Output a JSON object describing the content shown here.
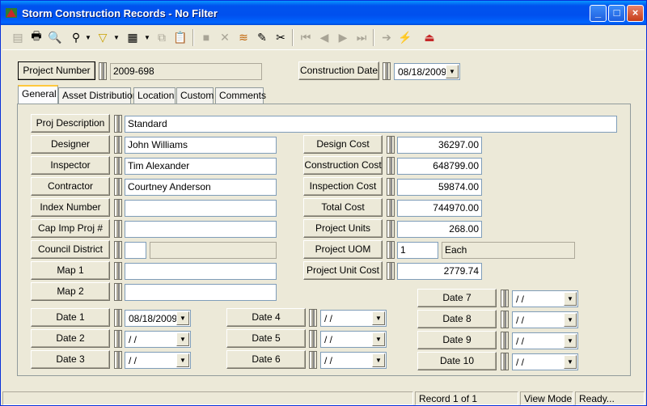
{
  "window": {
    "title": "Storm Construction Records - No Filter"
  },
  "title_buttons": {
    "minimize": "_",
    "maximize": "□",
    "close": "×"
  },
  "toolbar": {
    "icons": [
      "new-record-icon",
      "print-icon",
      "print-preview-icon",
      "find-icon",
      "filter-icon",
      "report-icon",
      "copy-icon",
      "paste-icon",
      "save-icon",
      "delete-icon",
      "add-icon",
      "edit-icon",
      "cut-icon",
      "first-record-icon",
      "previous-record-icon",
      "next-record-icon",
      "last-record-icon",
      "goto-icon",
      "refresh-icon",
      "exit-icon"
    ]
  },
  "header": {
    "project_number_label": "Project Number",
    "project_number_value": "2009-698",
    "construction_date_label": "Construction Date",
    "construction_date_value": "08/18/2009"
  },
  "tabs": [
    "General",
    "Asset Distribution",
    "Location",
    "Custom",
    "Comments"
  ],
  "active_tab": "General",
  "general": {
    "proj_description_label": "Proj Description",
    "proj_description_value": "Standard",
    "designer_label": "Designer",
    "designer_value": "John Williams",
    "inspector_label": "Inspector",
    "inspector_value": "Tim Alexander",
    "contractor_label": "Contractor",
    "contractor_value": "Courtney Anderson",
    "index_number_label": "Index Number",
    "index_number_value": "",
    "cap_imp_label": "Cap Imp Proj #",
    "cap_imp_value": "",
    "council_district_label": "Council District",
    "council_district_value": "",
    "council_district_name": "",
    "map1_label": "Map 1",
    "map1_value": "",
    "map2_label": "Map 2",
    "map2_value": "",
    "design_cost_label": "Design Cost",
    "design_cost_value": "36297.00",
    "construction_cost_label": "Construction Cost",
    "construction_cost_value": "648799.00",
    "inspection_cost_label": "Inspection Cost",
    "inspection_cost_value": "59874.00",
    "total_cost_label": "Total Cost",
    "total_cost_value": "744970.00",
    "project_units_label": "Project Units",
    "project_units_value": "268.00",
    "project_uom_label": "Project UOM",
    "project_uom_value": "1",
    "project_uom_desc": "Each",
    "project_unit_cost_label": "Project Unit Cost",
    "project_unit_cost_value": "2779.74",
    "dates": [
      {
        "label": "Date 1",
        "value": "08/18/2009"
      },
      {
        "label": "Date 2",
        "value": " /  /"
      },
      {
        "label": "Date 3",
        "value": " /  /"
      },
      {
        "label": "Date 4",
        "value": " /  /"
      },
      {
        "label": "Date 5",
        "value": " /  /"
      },
      {
        "label": "Date 6",
        "value": " /  /"
      },
      {
        "label": "Date 7",
        "value": " /  /"
      },
      {
        "label": "Date 8",
        "value": " /  /"
      },
      {
        "label": "Date 9",
        "value": " /  /"
      },
      {
        "label": "Date 10",
        "value": " /  /"
      }
    ]
  },
  "status": {
    "record": "Record 1 of 1",
    "mode": "View Mode",
    "state": "Ready..."
  }
}
